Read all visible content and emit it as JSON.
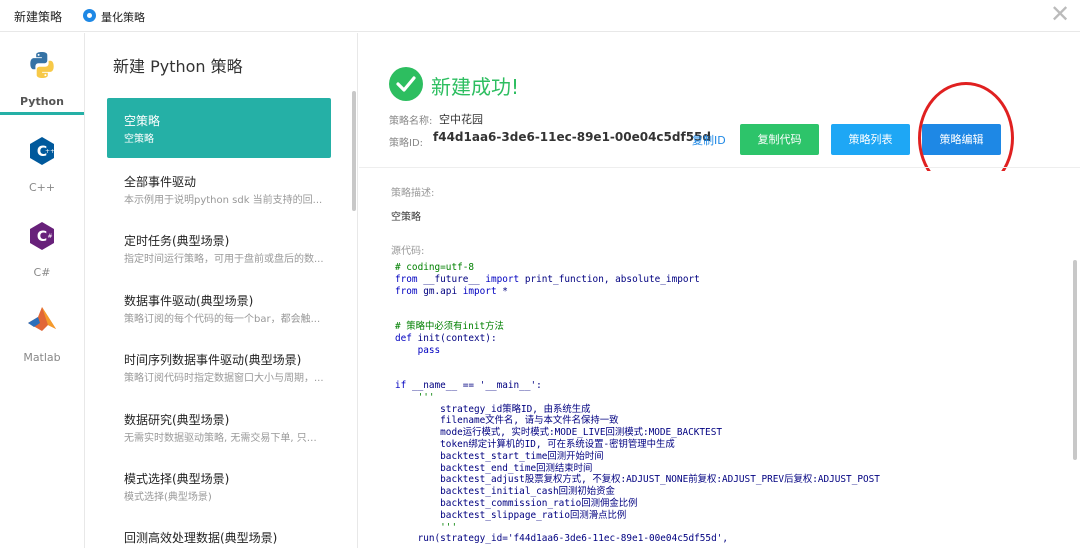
{
  "topbar": {
    "title": "新建策略",
    "radio_label": "量化策略",
    "close_glyph": "✕"
  },
  "languages": [
    {
      "label": "Python",
      "icon": "python-icon",
      "active": true
    },
    {
      "label": "C++",
      "icon": "cpp-icon",
      "active": false
    },
    {
      "label": "C#",
      "icon": "csharp-icon",
      "active": false
    },
    {
      "label": "Matlab",
      "icon": "matlab-icon",
      "active": false
    }
  ],
  "list": {
    "title": "新建 Python 策略",
    "items": [
      {
        "name": "空策略",
        "desc": "空策略"
      },
      {
        "name": "全部事件驱动",
        "desc": "本示例用于说明python sdk 当前支持的回..."
      },
      {
        "name": "定时任务(典型场景)",
        "desc": "指定时间运行策略，可用于盘前或盘后的数..."
      },
      {
        "name": "数据事件驱动(典型场景)",
        "desc": "策略订阅的每个代码的每一个bar，都会触..."
      },
      {
        "name": "时间序列数据事件驱动(典型场景)",
        "desc": "策略订阅代码时指定数据窗口大小与周期，..."
      },
      {
        "name": "数据研究(典型场景)",
        "desc": "无需实时数据驱动策略, 无需交易下单, 只是..."
      },
      {
        "name": "模式选择(典型场景)",
        "desc": "模式选择(典型场景)"
      },
      {
        "name": "回测高效处理数据(典型场景)",
        "desc": ""
      }
    ]
  },
  "main": {
    "success_text": "新建成功!",
    "name_label": "策略名称:",
    "name_value": "空中花园",
    "id_label": "策略ID:",
    "id_value": "f44d1aa6-3de6-11ec-89e1-00e04c5df55d",
    "copy_id": "复制ID",
    "btn_copy_code": "复制代码",
    "btn_strategy_list": "策略列表",
    "btn_strategy_edit": "策略编辑",
    "desc_label": "策略描述:",
    "desc_value": "空策略",
    "code_label": "源代码:",
    "code_lines": [
      "# coding=utf-8",
      "from __future__ import print_function, absolute_import",
      "from gm.api import *",
      "",
      "",
      "# 策略中必须有init方法",
      "def init(context):",
      "    pass",
      "",
      "",
      "if __name__ == '__main__':",
      "    '''",
      "        strategy_id策略ID, 由系统生成",
      "        filename文件名, 请与本文件名保持一致",
      "        mode运行模式, 实时模式:MODE_LIVE回测模式:MODE_BACKTEST",
      "        token绑定计算机的ID, 可在系统设置-密钥管理中生成",
      "        backtest_start_time回测开始时间",
      "        backtest_end_time回测结束时间",
      "        backtest_adjust股票复权方式, 不复权:ADJUST_NONE前复权:ADJUST_PREV后复权:ADJUST_POST",
      "        backtest_initial_cash回测初始资金",
      "        backtest_commission_ratio回测佣金比例",
      "        backtest_slippage_ratio回测滑点比例",
      "        '''",
      "    run(strategy_id='f44d1aa6-3de6-11ec-89e1-00e04c5df55d',"
    ]
  },
  "colors": {
    "teal": "#25b0a6",
    "green": "#2dc46a",
    "blue": "#1e88e5",
    "light_blue": "#1ea7f5",
    "red": "#e02020"
  }
}
